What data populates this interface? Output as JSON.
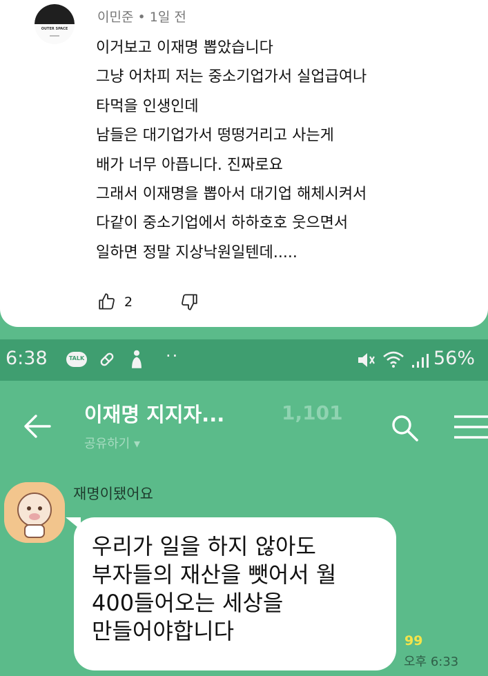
{
  "comment": {
    "avatar_logo_text": "OUTER SPACE",
    "author": "이민준",
    "separator": "•",
    "time": "1일 전",
    "lines": [
      "이거보고 이재명 뽑았습니다",
      "그냥 어차피 저는 중소기업가서 실업급여나",
      "타먹을 인생인데",
      "남들은 대기업가서 떵떵거리고 사는게",
      "배가 너무 아픕니다. 진짜로요",
      "그래서 이재명을 뽑아서 대기업 해체시켜서",
      "다같이 중소기업에서 하하호호 웃으면서",
      "일하면 정말 지상낙원일텐데....."
    ],
    "like_icon": "thumbs-up-icon",
    "like_count": "2",
    "dislike_icon": "thumbs-down-icon"
  },
  "status_bar": {
    "time": "6:38",
    "talk_icon_label": "TALK",
    "dots": "··",
    "battery": "56%"
  },
  "chat_header": {
    "title": "이재명 지지자...",
    "member_count": "1,101",
    "share_label": "공유하기 ▾"
  },
  "message": {
    "sender": "재명이됐어요",
    "lines": [
      "우리가 일을 하지 않아도",
      "부자들의 재산을 뺏어서 월",
      "400들어오는 세상을",
      "만들어야합니다"
    ],
    "unread": "99",
    "time": "오후 6:33"
  },
  "colors": {
    "chat_background": "#5bbb8a",
    "status_bar": "#3f9e70",
    "unread_badge": "#f5e44a"
  }
}
